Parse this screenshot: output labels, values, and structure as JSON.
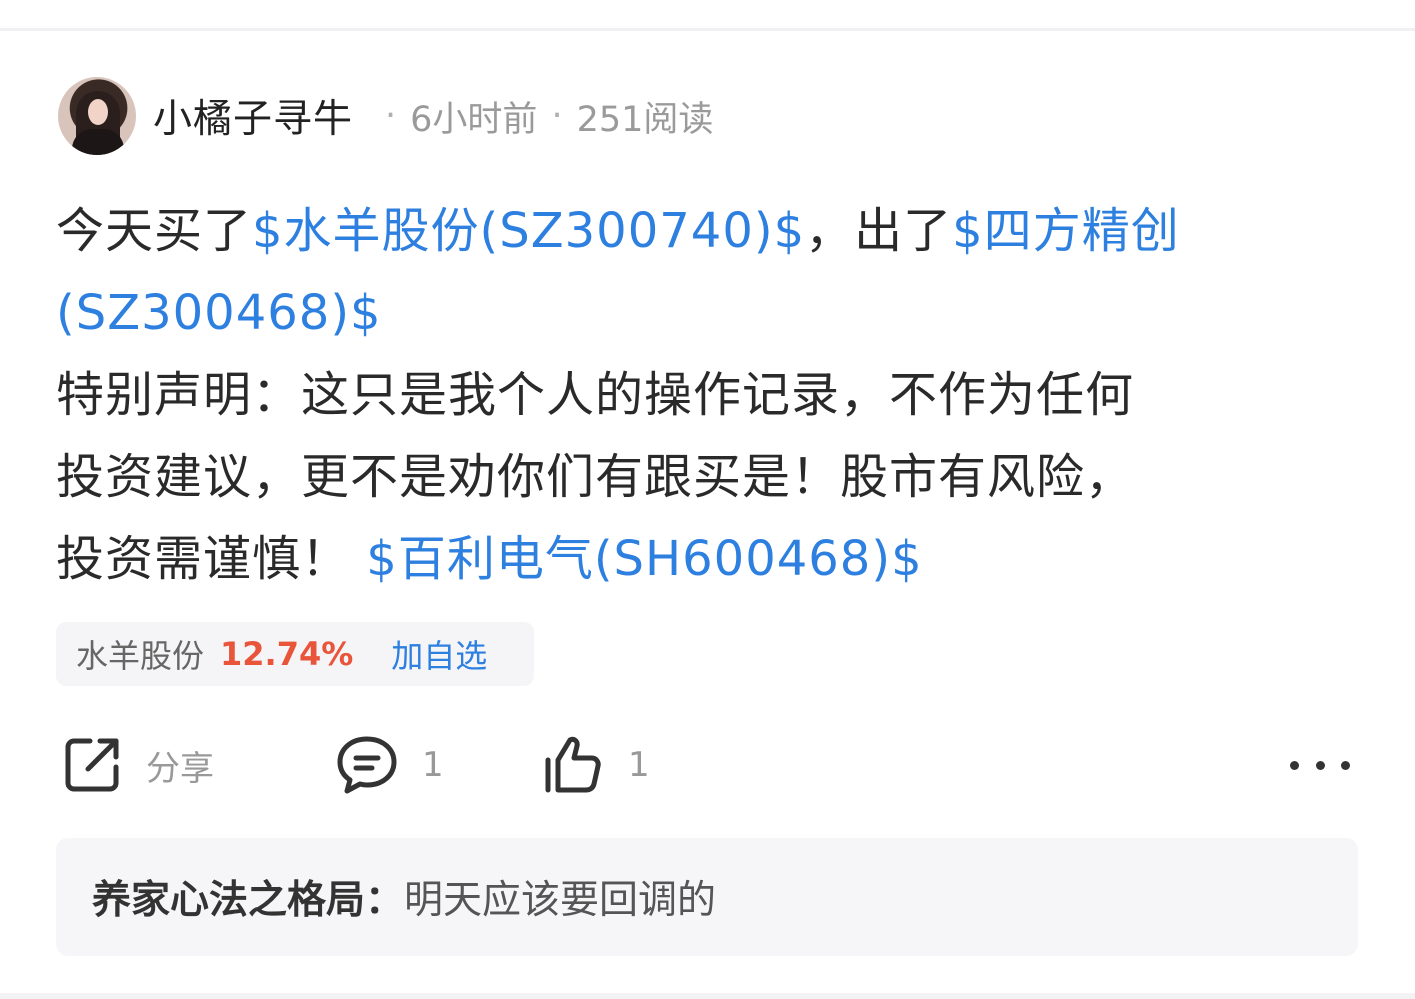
{
  "post": {
    "author": "小橘子寻牛",
    "time": "6小时前",
    "reads": "251阅读",
    "separator": "·",
    "body": {
      "p1_text1": "今天买了",
      "p1_link1": "$水羊股份(SZ300740)$",
      "p1_text2": "，出了",
      "p1_link2a": "$四方精创",
      "p1_link2b": "(SZ300468)$",
      "p2_line1": "特别声明：这只是我个人的操作记录，不作为任何",
      "p2_line2": "投资建议，更不是劝你们有跟买是！股市有风险，",
      "p2_line3_text": "投资需谨慎！",
      "p2_line3_link": "$百利电气(SH600468)$"
    }
  },
  "stock_chip": {
    "name": "水羊股份",
    "change": "12.74%",
    "add_label": "加自选"
  },
  "actions": {
    "share_label": "分享",
    "comment_count": "1",
    "like_count": "1"
  },
  "comment": {
    "author": "养家心法之格局：",
    "text": "明天应该要回调的"
  },
  "colors": {
    "link": "#2d7fe0",
    "change_up": "#e8553a"
  }
}
